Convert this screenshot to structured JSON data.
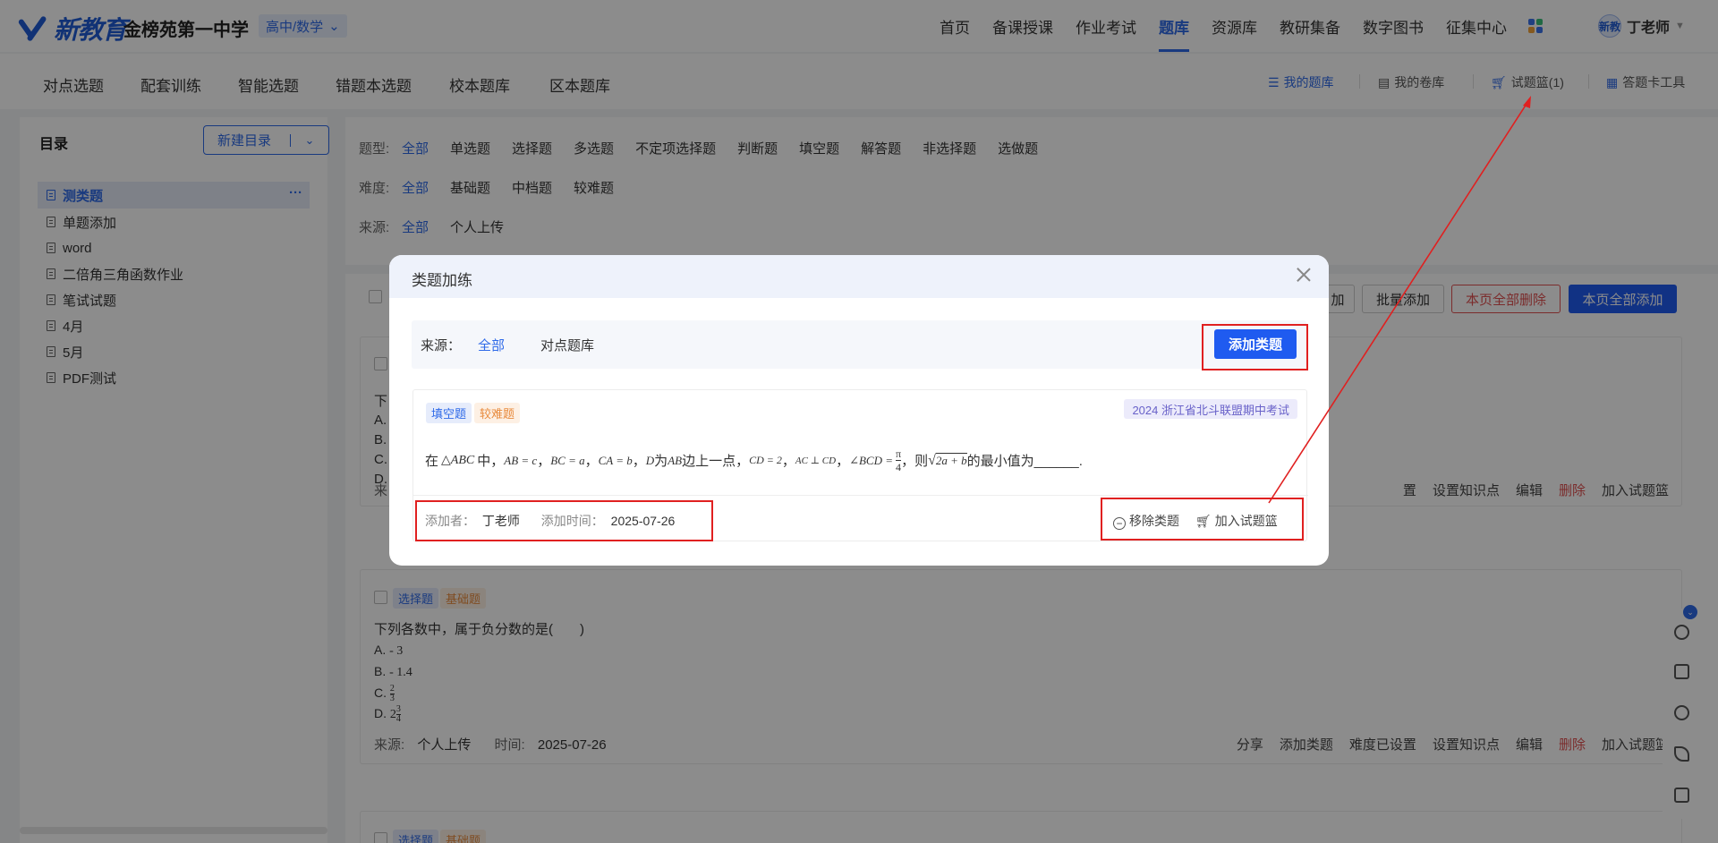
{
  "header": {
    "logo_text": "新教育",
    "school": "金榜苑第一中学",
    "subject": "高中/数学",
    "nav": [
      "首页",
      "备课授课",
      "作业考试",
      "题库",
      "资源库",
      "教研集备",
      "数字图书",
      "征集中心"
    ],
    "active_nav": "题库",
    "avatar_text": "新教",
    "user": "丁老师"
  },
  "subnav": {
    "tabs": [
      "对点选题",
      "配套训练",
      "智能选题",
      "错题本选题",
      "校本题库",
      "区本题库"
    ],
    "tools": {
      "my_bank": "我的题库",
      "my_papers": "我的卷库",
      "basket": "试题篮(1)",
      "answer_card": "答题卡工具"
    }
  },
  "sidebar": {
    "title": "目录",
    "new_button": "新建目录",
    "more": "···",
    "items": [
      "测类题",
      "单题添加",
      "word",
      "二倍角三角函数作业",
      "笔试试题",
      "4月",
      "5月",
      "PDF测试"
    ]
  },
  "filters": {
    "type_label": "题型:",
    "types": [
      "全部",
      "单选题",
      "选择题",
      "多选题",
      "不定项选择题",
      "判断题",
      "填空题",
      "解答题",
      "非选择题",
      "选做题"
    ],
    "difficulty_label": "难度:",
    "difficulties": [
      "全部",
      "基础题",
      "中档题",
      "较难题"
    ],
    "source_label": "来源:",
    "sources": [
      "全部",
      "个人上传"
    ]
  },
  "list_toolbar": {
    "partial_add": "加",
    "batch_add": "批量添加",
    "delete_page": "本页全部删除",
    "add_page": "本页全部添加"
  },
  "questions": [
    {
      "stem_start": "下",
      "option_letters": [
        "A.",
        "B.",
        "C.",
        "D."
      ],
      "source_start": "来",
      "actions": [
        "置",
        "设置知识点",
        "编辑",
        "删除",
        "加入试题篮"
      ]
    },
    {
      "tags": [
        "选择题",
        "基础题"
      ],
      "stem": "下列各数中，属于负分数的是(　　)",
      "options": {
        "a_label": "A.",
        "a": "- 3",
        "b_label": "B.",
        "b": "- 1.4",
        "c_label": "C.",
        "c_num": "2",
        "c_den": "3",
        "d_label": "D.",
        "d_whole": "2",
        "d_num": "3",
        "d_den": "4"
      },
      "source_label": "来源:",
      "source": "个人上传",
      "time_label": "时间:",
      "time": "2025-07-26",
      "actions": [
        "分享",
        "添加类题",
        "难度已设置",
        "设置知识点",
        "编辑",
        "删除",
        "加入试题篮"
      ]
    },
    {
      "tags": [
        "选择题",
        "基础题"
      ]
    }
  ],
  "modal": {
    "title": "类题加练",
    "source_label": "来源：",
    "source_options": [
      "全部",
      "对点题库"
    ],
    "add_button": "添加类题",
    "card": {
      "tags": [
        "填空题",
        "较难题"
      ],
      "exam_source": "2024 浙江省北斗联盟期中考试",
      "stem": {
        "p1": "在",
        "tri": "△ABC",
        "p2": "中，",
        "e1": "AB = c",
        "e2": "BC = a",
        "e3": "CA = b",
        "sep": "，",
        "d": "D",
        "p3": "为",
        "ab": "AB",
        "p4": "边上一点，",
        "cd": "CD = 2",
        "perp": "AC ⊥ CD",
        "ang": "∠BCD =",
        "pi": "π",
        "four": "4",
        "p5": "，则",
        "sqrt": "√",
        "rad": "2a + b",
        "p6": "的最小值为______."
      },
      "adder_label": "添加者：",
      "adder": "丁老师",
      "time_label": "添加时间：",
      "time": "2025-07-26",
      "remove": "移除类题",
      "add_basket": "加入试题篮"
    }
  },
  "colors": {
    "primary": "#2f6ae8",
    "primary_button": "#1f5bf0",
    "danger": "#e05050",
    "annotation_red": "#e02020",
    "tag_orange": "#e88a3c"
  }
}
